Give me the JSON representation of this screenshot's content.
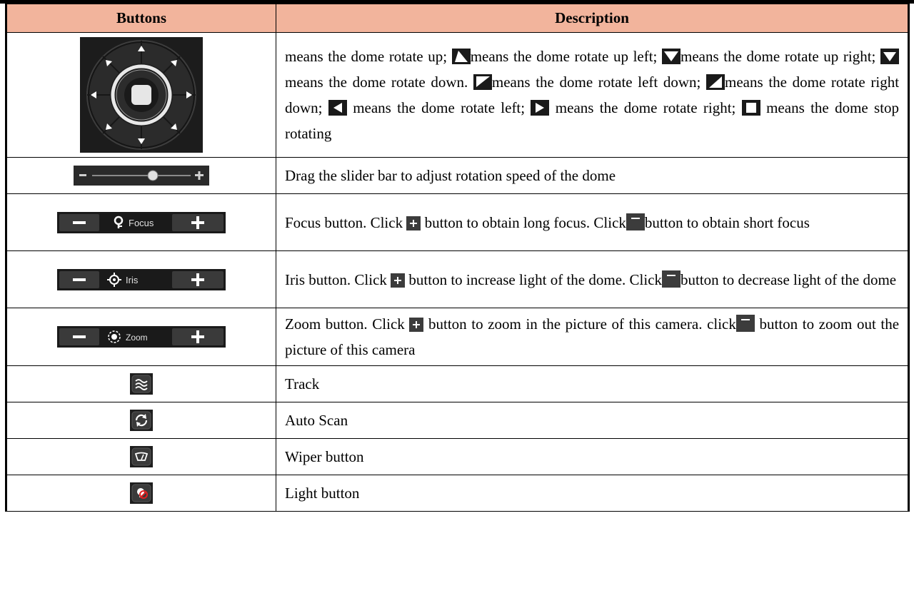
{
  "table": {
    "header": {
      "buttons": "Buttons",
      "description": "Description"
    },
    "ptz": {
      "t1": "means the dome rotate up;",
      "t2": "means the dome rotate up left;",
      "t3": "means the dome rotate up right;",
      "t4": "means the dome rotate down.",
      "t5": "means the dome rotate left down;",
      "t6": "means the dome rotate right down;",
      "t7": "means the dome rotate left;",
      "t8": "means the dome rotate right;",
      "t9": "means the dome stop rotating"
    },
    "speed": {
      "desc": "Drag the slider bar to adjust rotation speed of the dome"
    },
    "focus": {
      "label": "Focus",
      "d1": "Focus button. Click",
      "d2": "button to obtain long focus. Click",
      "d3": "button to obtain short focus"
    },
    "iris": {
      "label": "Iris",
      "d1": "Iris button. Click",
      "d2": "button to increase light of the dome. Click",
      "d3": "button to decrease light of the dome"
    },
    "zoom": {
      "label": "Zoom",
      "d1": "Zoom button. Click",
      "d2": "button to zoom in the picture of this camera.",
      "d3": "click",
      "d4": "button to zoom out the picture of this camera"
    },
    "track": {
      "desc": "Track"
    },
    "autoscan": {
      "desc": "Auto Scan"
    },
    "wiper": {
      "desc": "Wiper button"
    },
    "light": {
      "desc": "Light button"
    }
  }
}
